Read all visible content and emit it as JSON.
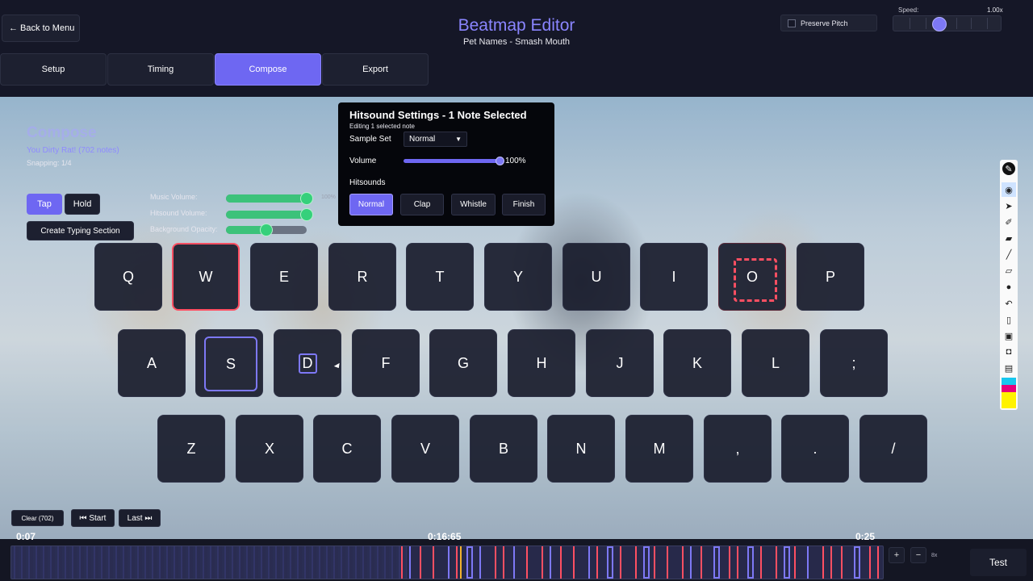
{
  "header": {
    "back_label": "← Back to Menu",
    "title": "Beatmap Editor",
    "subtitle": "Pet Names - Smash Mouth",
    "preserve_pitch_label": "Preserve Pitch",
    "speed_label": "Speed:",
    "speed_value": "1.00x"
  },
  "tabs": [
    "Setup",
    "Timing",
    "Compose",
    "Export"
  ],
  "active_tab": "Compose",
  "compose": {
    "title": "Compose",
    "song_line": "You Dirty Rat! (702 notes)",
    "snapping": "Snapping: 1/4",
    "tap_label": "Tap",
    "hold_label": "Hold",
    "typing_section_label": "Create Typing Section",
    "music_volume_label": "Music Volume:",
    "hitsound_volume_label": "Hitsound Volume:",
    "background_opacity_label": "Background Opacity:",
    "music_volume_pct": "100%",
    "music_volume": 1.0,
    "hitsound_volume": 1.0,
    "background_opacity": 0.5
  },
  "popup": {
    "title": "Hitsound Settings - 1 Note Selected",
    "subtitle": "Editing 1 selected note",
    "sample_set_label": "Sample Set",
    "sample_set_value": "Normal",
    "volume_label": "Volume",
    "volume_pct": "100%",
    "volume": 1.0,
    "hitsounds_label": "Hitsounds",
    "hitsounds": [
      "Normal",
      "Clap",
      "Whistle",
      "Finish"
    ],
    "active_hitsound": "Normal"
  },
  "keyboard": {
    "row1": [
      "Q",
      "W",
      "E",
      "R",
      "T",
      "Y",
      "U",
      "I",
      "O",
      "P"
    ],
    "row2": [
      "A",
      "S",
      "D",
      "F",
      "G",
      "H",
      "J",
      "K",
      "L",
      ";"
    ],
    "row3": [
      "Z",
      "X",
      "C",
      "V",
      "B",
      "N",
      "M",
      ",",
      ".",
      "/"
    ]
  },
  "playback": {
    "clear_label": "Clear (702)",
    "start_label": "⏮ Start",
    "last_label": "Last ⏭",
    "time_start": "0:07",
    "time_current": "0:16:65",
    "time_end": "0:25",
    "zoom_plus": "+",
    "zoom_minus": "−",
    "zoom_level": "8x",
    "test_label": "Test"
  },
  "colors": {
    "accent": "#6e67f2",
    "note_red": "#ff4f62",
    "note_blue": "#7d78f5",
    "volume_green": "#35d07b",
    "playhead": "#f1b22e"
  },
  "toolbar_icons": [
    "pen-tip-icon",
    "eye-icon",
    "pointer-icon",
    "pen-icon",
    "highlighter-icon",
    "line-icon",
    "eraser-icon",
    "dot-icon",
    "undo-icon",
    "trash-icon",
    "screen-icon",
    "camera-icon",
    "clipboard-icon",
    "color-swatch-icon"
  ]
}
